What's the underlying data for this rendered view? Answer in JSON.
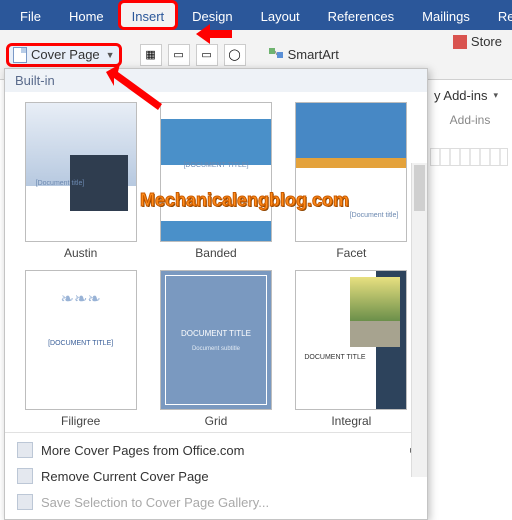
{
  "ribbon": {
    "tabs": [
      "File",
      "Home",
      "Insert",
      "Design",
      "Layout",
      "References",
      "Mailings",
      "Review"
    ],
    "active_tab": "Insert",
    "cover_page_label": "Cover Page",
    "smartart_label": "SmartArt",
    "store_label": "Store"
  },
  "right_panel": {
    "my_addins": "y Add-ins",
    "addins_header": "Add-ins"
  },
  "dropdown": {
    "section_header": "Built-in",
    "items": [
      {
        "name": "Austin"
      },
      {
        "name": "Banded"
      },
      {
        "name": "Facet"
      },
      {
        "name": "Filigree"
      },
      {
        "name": "Grid"
      },
      {
        "name": "Integral"
      }
    ],
    "thumb_text": {
      "austin": "[Document title]",
      "banded": "[DOCUMENT TITLE]",
      "facet": "[Document title]",
      "filigree": "[DOCUMENT TITLE]",
      "grid_line1": "DOCUMENT TITLE",
      "grid_line2": "Document subtitle",
      "integral": "DOCUMENT TITLE"
    },
    "footer": {
      "more": "More Cover Pages from Office.com",
      "remove": "Remove Current Cover Page",
      "save_gallery": "Save Selection to Cover Page Gallery..."
    }
  },
  "watermark": "Mechanicalengblog.com"
}
